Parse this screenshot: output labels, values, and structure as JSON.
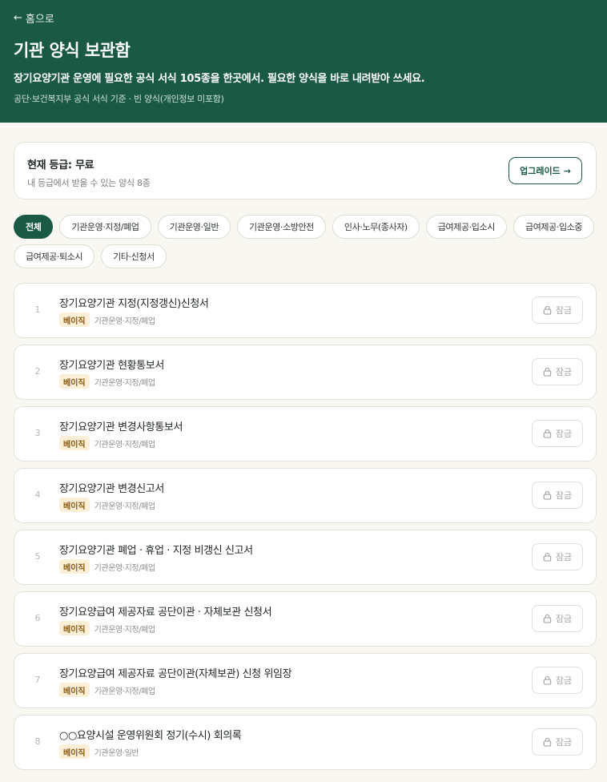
{
  "header": {
    "back_label": "홈으로",
    "title": "기관 양식 보관함",
    "subtitle": "장기요양기관 운영에 필요한 공식 서식 105종을 한곳에서. 필요한 양식을 바로 내려받아 쓰세요.",
    "note": "공단·보건복지부 공식 서식 기준 · 빈 양식(개인정보 미포함)"
  },
  "plan": {
    "title": "현재 등급: 무료",
    "subtitle": "내 등급에서 받을 수 있는 양식 8종",
    "upgrade_label": "업그레이드",
    "upgrade_icon": "arrow-right-icon"
  },
  "filters": [
    {
      "label": "전체",
      "active": true
    },
    {
      "label": "기관운영·지정/폐업",
      "active": false
    },
    {
      "label": "기관운영·일반",
      "active": false
    },
    {
      "label": "기관운영·소방안전",
      "active": false
    },
    {
      "label": "인사·노무(종사자)",
      "active": false
    },
    {
      "label": "급여제공·입소시",
      "active": false
    },
    {
      "label": "급여제공·입소중",
      "active": false
    },
    {
      "label": "급여제공·퇴소시",
      "active": false
    },
    {
      "label": "기타·신청서",
      "active": false
    }
  ],
  "forms": [
    {
      "num": "1",
      "title": "장기요양기관 지정(지정갱신)신청서",
      "tier": "베이직",
      "category": "기관운영·지정/폐업",
      "action": "잠금"
    },
    {
      "num": "2",
      "title": "장기요양기관 현황통보서",
      "tier": "베이직",
      "category": "기관운영·지정/폐업",
      "action": "잠금"
    },
    {
      "num": "3",
      "title": "장기요양기관 변경사항통보서",
      "tier": "베이직",
      "category": "기관운영·지정/폐업",
      "action": "잠금"
    },
    {
      "num": "4",
      "title": "장기요양기관 변경신고서",
      "tier": "베이직",
      "category": "기관운영·지정/폐업",
      "action": "잠금"
    },
    {
      "num": "5",
      "title": "장기요양기관 폐업 · 휴업 · 지정 비갱신 신고서",
      "tier": "베이직",
      "category": "기관운영·지정/폐업",
      "action": "잠금"
    },
    {
      "num": "6",
      "title": "장기요양급여 제공자료 공단이관 · 자체보관 신청서",
      "tier": "베이직",
      "category": "기관운영·지정/폐업",
      "action": "잠금"
    },
    {
      "num": "7",
      "title": "장기요양급여 제공자료 공단이관(자체보관) 신청 위임장",
      "tier": "베이직",
      "category": "기관운영·지정/폐업",
      "action": "잠금"
    },
    {
      "num": "8",
      "title": "○○요양시설 운영위원회 정기(수시) 회의록",
      "tier": "베이직",
      "category": "기관운영·일반",
      "action": "잠금"
    }
  ],
  "colors": {
    "brand": "#1a5a45",
    "badge_bg": "#fbefd7",
    "badge_text": "#8a5a12",
    "page_bg": "#f8f7f2"
  }
}
